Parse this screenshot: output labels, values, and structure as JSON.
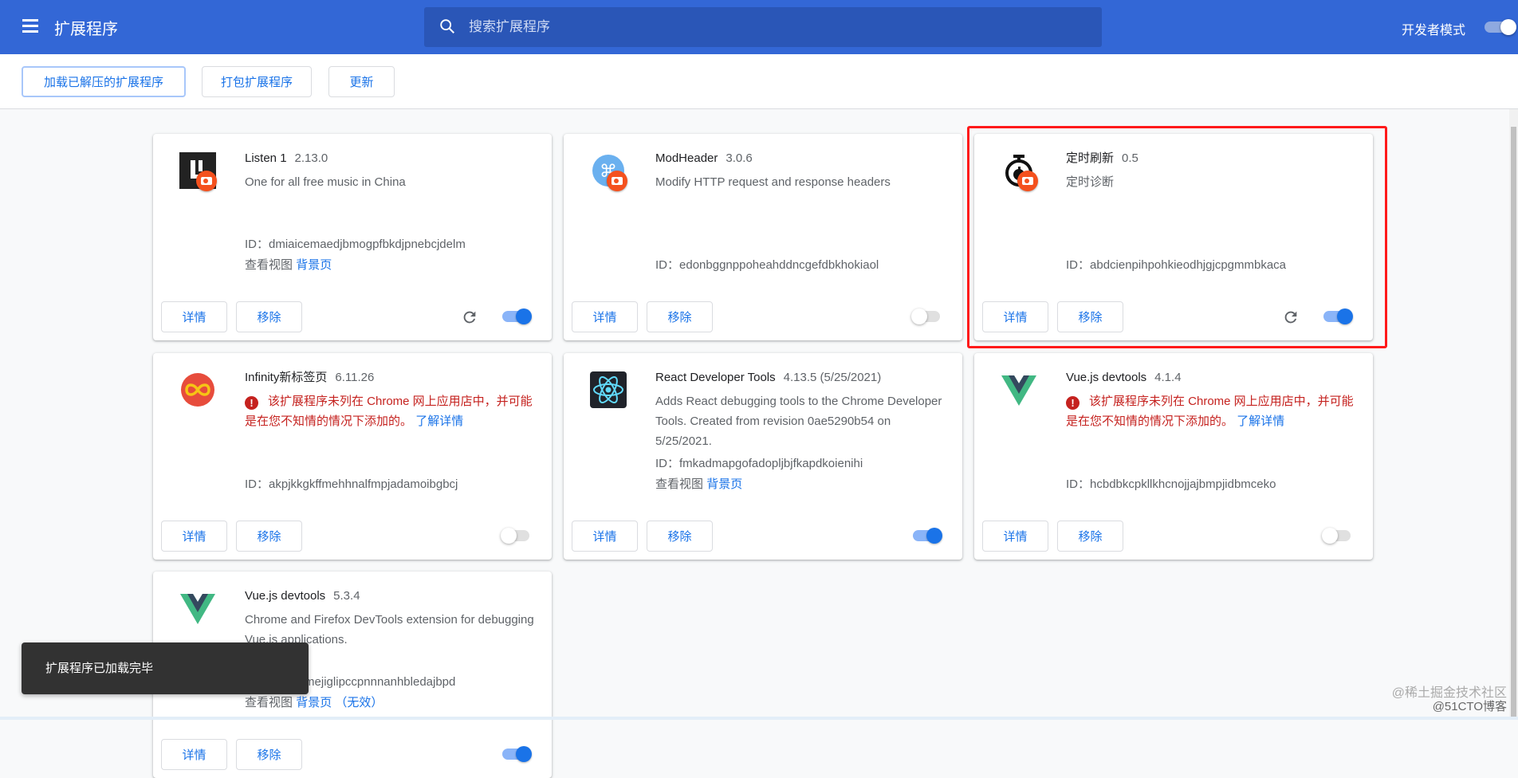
{
  "header": {
    "title": "扩展程序",
    "search_placeholder": "搜索扩展程序",
    "dev_mode_label": "开发者模式",
    "dev_mode_on": true
  },
  "toolbar": {
    "load_unpacked": "加载已解压的扩展程序",
    "pack": "打包扩展程序",
    "update": "更新"
  },
  "card_labels": {
    "details": "详情",
    "remove": "移除",
    "id_prefix": "ID：",
    "inspect_views": "查看视图",
    "background_page": "背景页",
    "inactive": "（无效）",
    "learn_more": "了解详情"
  },
  "extensions": [
    {
      "name": "Listen 1",
      "version": "2.13.0",
      "icon": "listen1-icon",
      "dev_badge": true,
      "description": "One for all free music in China",
      "id": "dmiaicemaedjbmogpfbkdjpnebcjdelm",
      "views": true,
      "reload": true,
      "enabled": true
    },
    {
      "name": "ModHeader",
      "version": "3.0.6",
      "icon": "modheader-icon",
      "dev_badge": true,
      "description": "Modify HTTP request and response headers",
      "id": "edonbggnppoheahddncgefdbkhokiaol",
      "views": false,
      "reload": false,
      "enabled": false
    },
    {
      "name": "定时刷新",
      "version": "0.5",
      "icon": "stopwatch-icon",
      "dev_badge": true,
      "description": "定时诊断",
      "id": "abdcienpihpohkieodhjgjcpgmmbkaca",
      "views": false,
      "reload": true,
      "enabled": true,
      "highlighted": true
    },
    {
      "name": "Infinity新标签页",
      "version": "6.11.26",
      "icon": "infinity-icon",
      "dev_badge": false,
      "warning": "该扩展程序未列在 Chrome 网上应用店中，并可能是在您不知情的情况下添加的。",
      "id": "akpjkkgkffmehhnalfmpjadamoibgbcj",
      "views": false,
      "reload": false,
      "enabled": false
    },
    {
      "name": "React Developer Tools",
      "version": "4.13.5 (5/25/2021)",
      "icon": "react-icon",
      "dev_badge": false,
      "description": "Adds React debugging tools to the Chrome Developer Tools. Created from revision 0ae5290b54 on 5/25/2021.",
      "id": "fmkadmapgofadopljbjfkapdkoienihi",
      "views": true,
      "reload": false,
      "enabled": true
    },
    {
      "name": "Vue.js devtools",
      "version": "4.1.4",
      "icon": "vue-icon",
      "dev_badge": false,
      "warning": "该扩展程序未列在 Chrome 网上应用店中，并可能是在您不知情的情况下添加的。",
      "id": "hcbdbkcpkllkhcnojjajbmpjidbmceko",
      "views": false,
      "reload": false,
      "enabled": false
    },
    {
      "name": "Vue.js devtools",
      "version": "5.3.4",
      "icon": "vue-icon",
      "dev_badge": false,
      "description": "Chrome and Firefox DevTools extension for debugging Vue.js applications.",
      "id": "nhdogjmejiglipccpnnnanhbledajbpd",
      "views": true,
      "views_inactive": true,
      "reload": false,
      "enabled": true
    }
  ],
  "toast": "扩展程序已加载完毕",
  "watermark": {
    "line1": "@稀土掘金技术社区",
    "line2": "@51CTO博客"
  }
}
